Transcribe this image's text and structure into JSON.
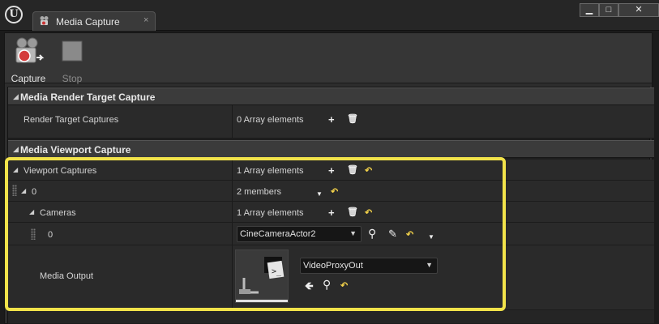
{
  "window": {
    "tab_title": "Media Capture",
    "tab_close_glyph": "×",
    "buttons": {
      "minimize": "▁",
      "maximize": "□",
      "close": "✕"
    }
  },
  "toolbar": {
    "capture_label": "Capture",
    "stop_label": "Stop"
  },
  "sections": {
    "render_target": {
      "title": "Media Render Target Capture",
      "rows": {
        "render_target_captures": {
          "name": "Render Target Captures",
          "value": "0 Array elements"
        }
      }
    },
    "viewport": {
      "title": "Media Viewport Capture",
      "rows": {
        "viewport_captures": {
          "name": "Viewport Captures",
          "value": "1 Array elements"
        },
        "index0": {
          "name": "0",
          "value": "2 members"
        },
        "cameras": {
          "name": "Cameras",
          "value": "1 Array elements"
        },
        "camera0": {
          "name": "0",
          "value": "CineCameraActor2"
        },
        "media_output": {
          "name": "Media Output",
          "value": "VideoProxyOut"
        }
      }
    }
  },
  "icons": {
    "add": "+",
    "delete": "🗑",
    "reset": "↶",
    "search": "⚲",
    "picker": "✎",
    "dropdown": "▼",
    "use_selected": "🡸"
  },
  "colors": {
    "highlight": "#f2e34a",
    "reset_icon": "#f0d04a"
  }
}
